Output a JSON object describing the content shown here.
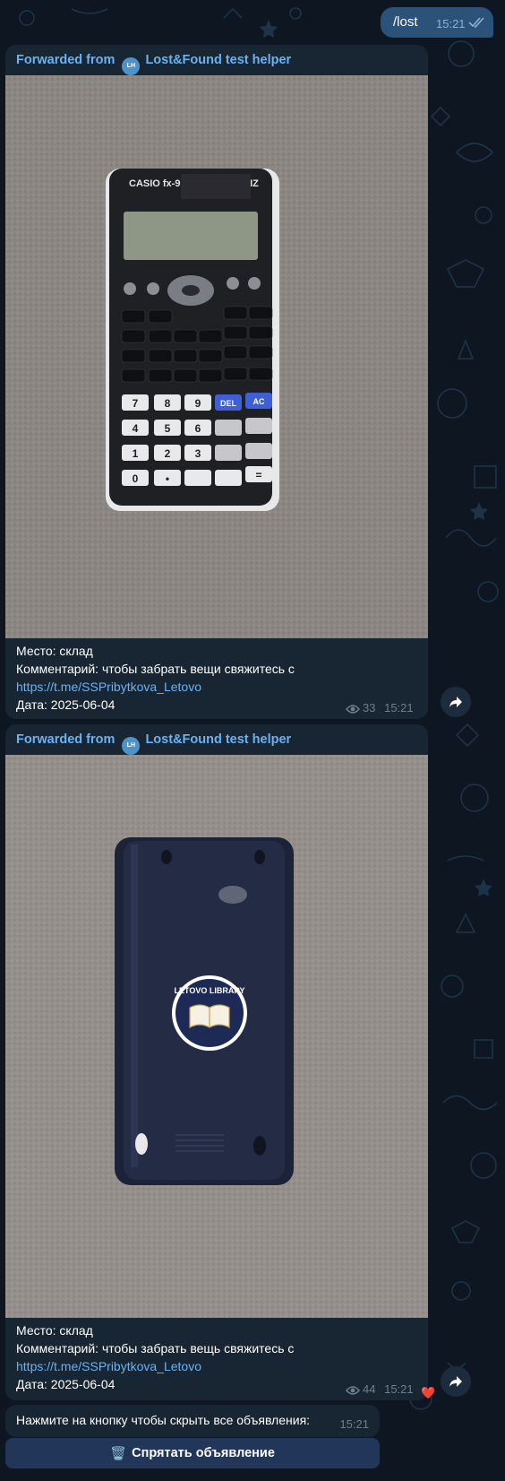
{
  "outgoing": {
    "text": "/lost",
    "time": "15:21"
  },
  "messages": [
    {
      "forwarded_prefix": "Forwarded from",
      "avatar_initials": "LH",
      "source_name": "Lost&Found test helper",
      "photo_alt": "CASIO fx-991EX CLASSWIZ",
      "place": "Место: склад",
      "comment": "Комментарий: чтобы забрать вещи свяжитесь с",
      "link": "https://t.me/SSPribytkova_Letovo",
      "date": "Дата: 2025-06-04",
      "views": "33",
      "time": "15:21"
    },
    {
      "forwarded_prefix": "Forwarded from",
      "avatar_initials": "LH",
      "source_name": "Lost&Found test helper",
      "photo_alt": "LETOVO LIBRARY",
      "place": "Место: склад",
      "comment": "Комментарий: чтобы забрать вещь свяжитесь с",
      "link": "https://t.me/SSPribytkova_Letovo",
      "date": "Дата: 2025-06-04",
      "views": "44",
      "time": "15:21",
      "reaction": "❤️"
    }
  ],
  "prompt": {
    "text": "Нажмите на кнопку чтобы скрыть все объявления:",
    "time": "15:21"
  },
  "action_button": {
    "icon": "🗑️",
    "label": "Спрятать объявление"
  },
  "colors": {
    "background": "#0e1621",
    "bubble": "#182533",
    "outgoing": "#2b5278",
    "link": "#6ab2f2",
    "button": "#22365a"
  },
  "icons": [
    "eye-icon",
    "share-icon",
    "double-check-icon",
    "trash-icon",
    "heart-reaction"
  ]
}
